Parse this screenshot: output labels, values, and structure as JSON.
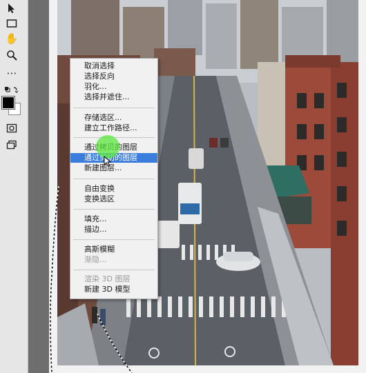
{
  "toolbar": {
    "icons": [
      "arrow-tool-icon",
      "rectangle-marquee-icon",
      "hand-tool-icon",
      "zoom-tool-icon",
      "more-tools-icon",
      "swap-colors-icon",
      "foreground-color-swatch",
      "quick-mask-icon",
      "screen-mode-icon"
    ],
    "foreground_color": "#000000",
    "background_color": "#ffffff"
  },
  "context_menu": {
    "items": [
      {
        "label": "取消选择",
        "state": "enabled"
      },
      {
        "label": "选择反向",
        "state": "enabled"
      },
      {
        "label": "羽化...",
        "state": "enabled"
      },
      {
        "label": "选择并遮住...",
        "state": "enabled"
      },
      {
        "label": "存储选区...",
        "state": "enabled"
      },
      {
        "label": "建立工作路径...",
        "state": "enabled"
      },
      {
        "label": "通过拷贝的图层",
        "state": "enabled"
      },
      {
        "label": "通过剪切的图层",
        "state": "highlighted"
      },
      {
        "label": "新建图层...",
        "state": "enabled"
      },
      {
        "label": "自由变换",
        "state": "enabled"
      },
      {
        "label": "变换选区",
        "state": "enabled"
      },
      {
        "label": "填充...",
        "state": "enabled"
      },
      {
        "label": "描边...",
        "state": "enabled"
      },
      {
        "label": "高斯模糊",
        "state": "enabled"
      },
      {
        "label": "渐隐...",
        "state": "disabled"
      },
      {
        "label": "渲染 3D 图层",
        "state": "disabled"
      },
      {
        "label": "新建 3D 模型",
        "state": "enabled"
      }
    ],
    "highlight_color": "#3b7ddd"
  },
  "canvas": {
    "image_subject": "city street photo",
    "sky_color": "#c9ced2",
    "road_color": "#5b6066",
    "brick_color": "#9c4a3a"
  }
}
